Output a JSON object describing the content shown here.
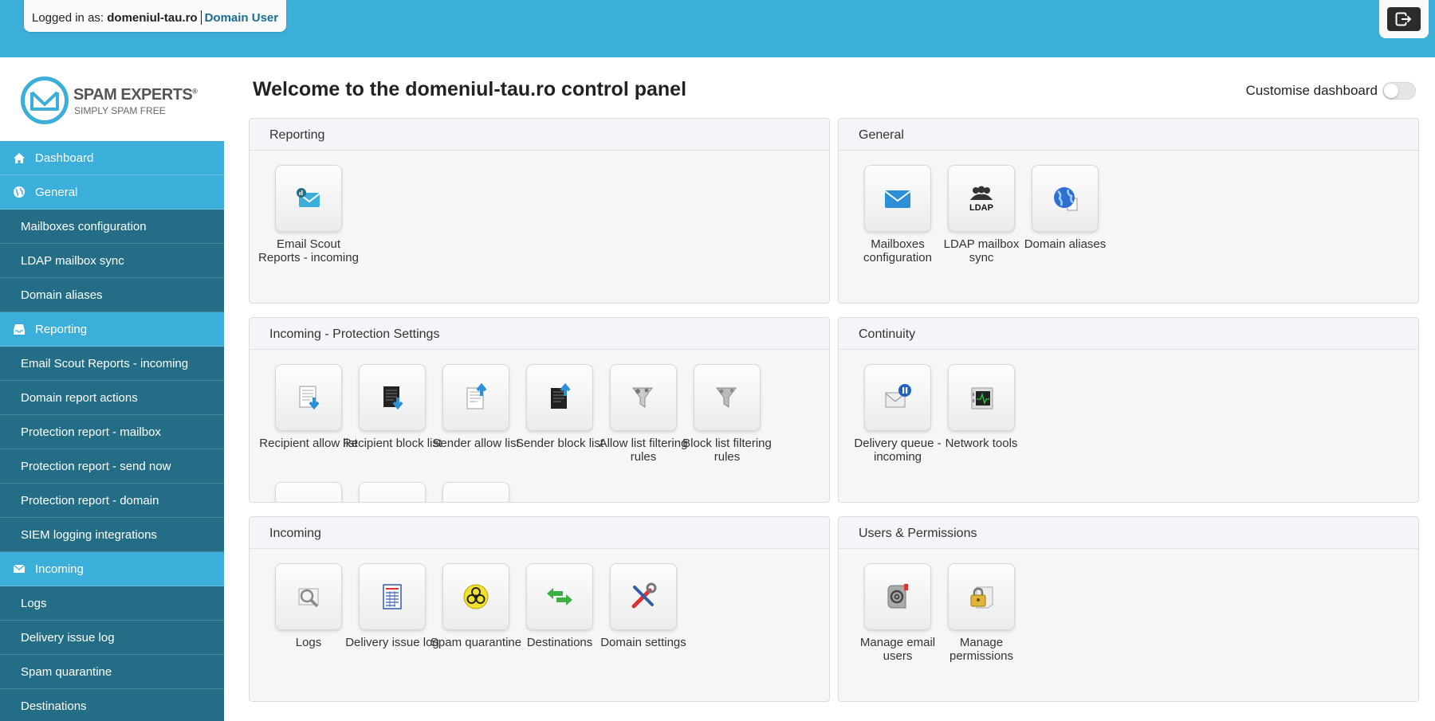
{
  "topbar": {
    "logged_in_prefix": "Logged in as:",
    "domain": "domeniul-tau.ro",
    "role": "Domain User",
    "logout_icon": "logout-icon"
  },
  "logo": {
    "brand": "SPAM EXPERTS",
    "registered": "®",
    "tagline": "SIMPLY SPAM FREE"
  },
  "sidebar": {
    "items": [
      {
        "label": "Dashboard",
        "type": "head",
        "icon": "home-icon"
      },
      {
        "label": "General",
        "type": "head",
        "icon": "globe-icon"
      },
      {
        "label": "Mailboxes configuration",
        "type": "sub"
      },
      {
        "label": "LDAP mailbox sync",
        "type": "sub"
      },
      {
        "label": "Domain aliases",
        "type": "sub"
      },
      {
        "label": "Reporting",
        "type": "head",
        "icon": "inbox-icon"
      },
      {
        "label": "Email Scout Reports - incoming",
        "type": "sub"
      },
      {
        "label": "Domain report actions",
        "type": "sub"
      },
      {
        "label": "Protection report - mailbox",
        "type": "sub"
      },
      {
        "label": "Protection report - send now",
        "type": "sub"
      },
      {
        "label": "Protection report - domain",
        "type": "sub"
      },
      {
        "label": "SIEM logging integrations",
        "type": "sub"
      },
      {
        "label": "Incoming",
        "type": "head",
        "icon": "envelope-icon"
      },
      {
        "label": "Logs",
        "type": "sub"
      },
      {
        "label": "Delivery issue log",
        "type": "sub"
      },
      {
        "label": "Spam quarantine",
        "type": "sub"
      },
      {
        "label": "Destinations",
        "type": "sub"
      }
    ]
  },
  "main": {
    "title": "Welcome to the domeniul-tau.ro control panel",
    "customise_label": "Customise dashboard",
    "customise_on": false
  },
  "panels": {
    "reporting": {
      "title": "Reporting",
      "tiles": [
        {
          "label": "Email Scout Reports - incoming",
          "icon": "email-scout-icon"
        }
      ]
    },
    "general": {
      "title": "General",
      "tiles": [
        {
          "label": "Mailboxes configuration",
          "icon": "mailbox-icon"
        },
        {
          "label": "LDAP mailbox sync",
          "icon": "ldap-icon",
          "icon_text": "LDAP"
        },
        {
          "label": "Domain aliases",
          "icon": "globe-icon"
        }
      ]
    },
    "protection": {
      "title": "Incoming - Protection Settings",
      "tiles": [
        {
          "label": "Recipient allow list",
          "icon": "recipient-allow-icon"
        },
        {
          "label": "Recipient block list",
          "icon": "recipient-block-icon"
        },
        {
          "label": "Sender allow list",
          "icon": "sender-allow-icon"
        },
        {
          "label": "Sender block list",
          "icon": "sender-block-icon"
        },
        {
          "label": "Allow list filtering rules",
          "icon": "allow-filter-icon"
        },
        {
          "label": "Block list filtering rules",
          "icon": "block-filter-icon"
        }
      ]
    },
    "continuity": {
      "title": "Continuity",
      "tiles": [
        {
          "label": "Delivery queue - incoming",
          "icon": "delivery-queue-icon"
        },
        {
          "label": "Network tools",
          "icon": "network-tools-icon"
        }
      ]
    },
    "incoming": {
      "title": "Incoming",
      "tiles": [
        {
          "label": "Logs",
          "icon": "logs-icon"
        },
        {
          "label": "Delivery issue log",
          "icon": "delivery-log-icon"
        },
        {
          "label": "Spam quarantine",
          "icon": "biohazard-icon"
        },
        {
          "label": "Destinations",
          "icon": "destinations-icon"
        },
        {
          "label": "Domain settings",
          "icon": "domain-settings-icon"
        }
      ]
    },
    "users": {
      "title": "Users & Permissions",
      "tiles": [
        {
          "label": "Manage email users",
          "icon": "email-users-icon"
        },
        {
          "label": "Manage permissions",
          "icon": "permissions-lock-icon"
        }
      ]
    }
  }
}
